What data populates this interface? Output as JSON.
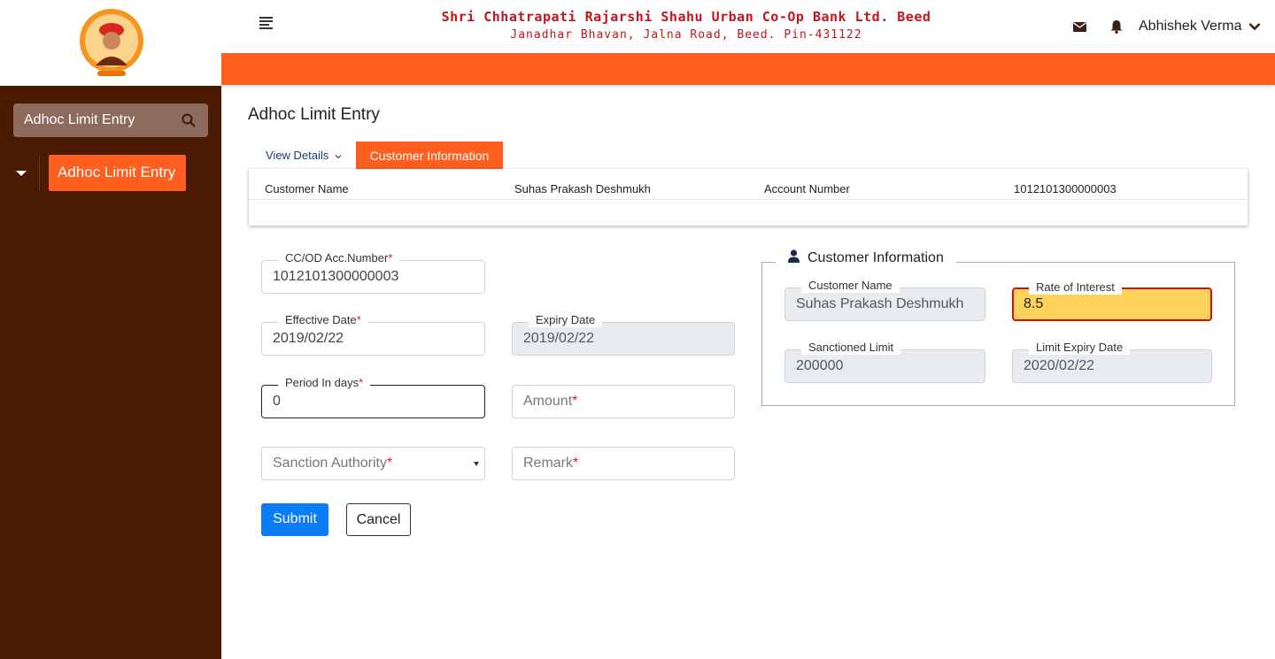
{
  "brand": {
    "bank_name": "Shri Chhatrapati Rajarshi Shahu Urban Co-Op Bank Ltd. Beed",
    "address": "Janadhar Bhavan, Jalna Road, Beed. Pin-431122"
  },
  "header": {
    "user_name": "Abhishek Verma"
  },
  "sidebar": {
    "search_label": "Adhoc Limit Entry",
    "active_item": "Adhoc Limit Entry"
  },
  "page": {
    "title": "Adhoc Limit Entry",
    "tabs": [
      {
        "label": "View Details"
      },
      {
        "label": "Customer Information"
      }
    ]
  },
  "info_card": {
    "customer_name_label": "Customer Name",
    "customer_name_value": "Suhas Prakash Deshmukh",
    "account_number_label": "Account Number",
    "account_number_value": "1012101300000003"
  },
  "form": {
    "ccod_label": "CC/OD Acc.Number",
    "ccod_value": "1012101300000003",
    "effective_date_label": "Effective Date",
    "effective_date_value": "2019/02/22",
    "expiry_date_label": "Expiry Date",
    "expiry_date_value": "2019/02/22",
    "period_label": "Period In days",
    "period_value": "0",
    "amount_placeholder": "Amount",
    "sanction_authority_placeholder": "Sanction Authority",
    "remark_placeholder": "Remark",
    "required_mark": "*",
    "submit_label": "Submit",
    "cancel_label": "Cancel"
  },
  "customer_info": {
    "legend": "Customer Information",
    "customer_name_label": "Customer Name",
    "customer_name_value": "Suhas Prakash Deshmukh",
    "rate_label": "Rate of Interest",
    "rate_value": "8.5",
    "sanctioned_label": "Sanctioned Limit",
    "sanctioned_value": "200000",
    "limit_expiry_label": "Limit Expiry Date",
    "limit_expiry_value": "2020/02/22"
  },
  "colors": {
    "accent": "#ff5e1f",
    "sidebar_bg": "#4a1a03",
    "brand_text": "#c0161c",
    "submit": "#0a7cf8",
    "highlight": "#ffd35a"
  },
  "icons": [
    "menu-icon",
    "mail-icon",
    "bell-icon",
    "chevron-down-icon",
    "search-icon",
    "caret-down-icon",
    "user-icon",
    "bank-logo"
  ]
}
